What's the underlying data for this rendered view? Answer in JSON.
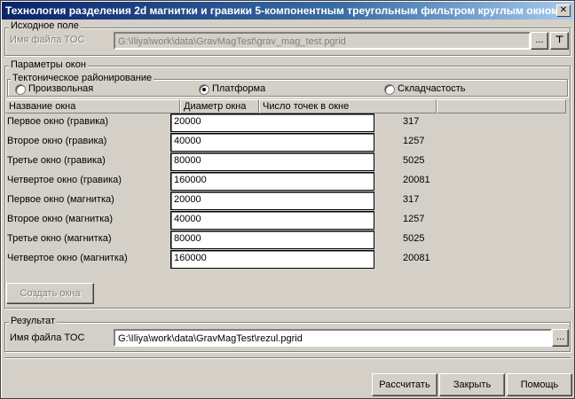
{
  "window": {
    "title": "Технология разделения 2d магнитки и гравики 5-компонентным  треугольным фильтром круглым окном",
    "close_symbol": "✕"
  },
  "source": {
    "group_title": "Исходное поле",
    "file_label": "Имя файла TOC",
    "file_value": "G:\\Iliya\\work\\data\\GravMagTest\\grav_mag_test.pgrid",
    "browse_label": "...",
    "pin_symbol": "⊤"
  },
  "params": {
    "group_title": "Параметры окон",
    "tectonic": {
      "group_title": "Тектоническое районирование",
      "options": [
        "Произвольная",
        "Платформа",
        "Складчастость"
      ],
      "selected": 1
    },
    "table": {
      "headers": [
        "Название окна",
        "Диаметр окна",
        "Число точек в окне"
      ],
      "rows": [
        {
          "name": "Первое окно (гравика)",
          "diameter": "20000",
          "points": "317"
        },
        {
          "name": "Второе окно (гравика)",
          "diameter": "40000",
          "points": "1257"
        },
        {
          "name": "Третье окно (гравика)",
          "diameter": "80000",
          "points": "5025"
        },
        {
          "name": "Четвертое окно (гравика)",
          "diameter": "160000",
          "points": "20081"
        },
        {
          "name": "Первое окно (магнитка)",
          "diameter": "20000",
          "points": "317"
        },
        {
          "name": "Второе окно (магнитка)",
          "diameter": "40000",
          "points": "1257"
        },
        {
          "name": "Третье окно (магнитка)",
          "diameter": "80000",
          "points": "5025"
        },
        {
          "name": "Четвертое окно (магнитка)",
          "diameter": "160000",
          "points": "20081"
        }
      ]
    },
    "create_button": "Создать окна"
  },
  "result": {
    "group_title": "Результат",
    "file_label": "Имя файла TOC",
    "file_value": "G:\\Iliya\\work\\data\\GravMagTest\\rezul.pgrid",
    "browse_label": "..."
  },
  "footer": {
    "calculate": "Рассчитать",
    "close": "Закрыть",
    "help": "Помощь"
  }
}
